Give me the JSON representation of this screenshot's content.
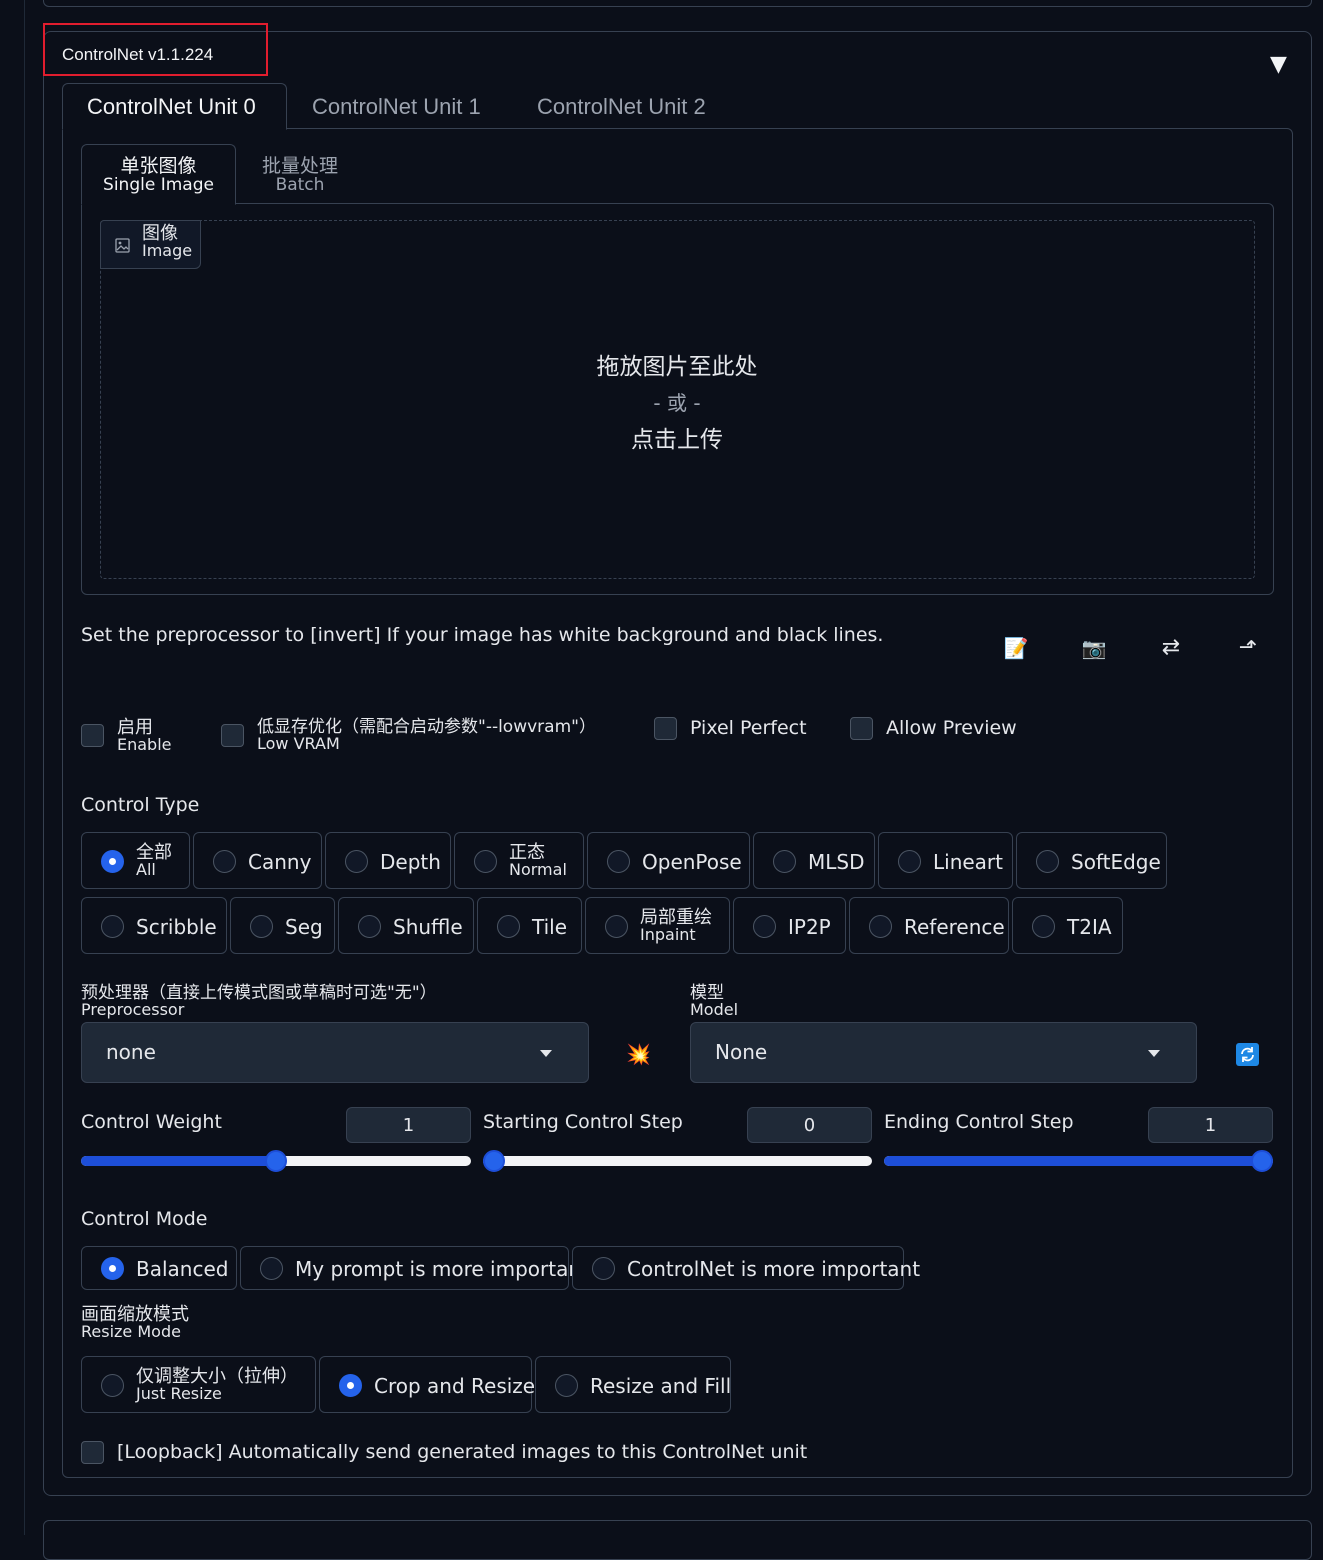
{
  "accordion": {
    "title": "ControlNet v1.1.224",
    "toggle_glyph": "▼"
  },
  "unit_tabs": [
    "ControlNet Unit 0",
    "ControlNet Unit 1",
    "ControlNet Unit 2"
  ],
  "input_tabs": {
    "single": {
      "cn": "单张图像",
      "en": "Single Image"
    },
    "batch": {
      "cn": "批量处理",
      "en": "Batch"
    }
  },
  "image_upload": {
    "label_cn": "图像",
    "label_en": "Image",
    "drop_text": "拖放图片至此处",
    "or_text": "- 或 -",
    "click_text": "点击上传"
  },
  "hint": "Set the preprocessor to [invert] If your image has white background and black lines.",
  "toolbar": {
    "edit": "📝",
    "camera": "📷",
    "swap": "⇄",
    "send": "⬏"
  },
  "options": {
    "enable": {
      "cn": "启用",
      "en": "Enable",
      "checked": false
    },
    "low_vram": {
      "cn": "低显存优化（需配合启动参数\"--lowvram\"）",
      "en": "Low VRAM",
      "checked": false
    },
    "pixel_perfect": {
      "label": "Pixel Perfect",
      "checked": false
    },
    "allow_preview": {
      "label": "Allow Preview",
      "checked": false
    }
  },
  "control_type": {
    "label": "Control Type",
    "selected": "all",
    "row1": [
      {
        "cn": "全部",
        "en": "All"
      },
      {
        "label": "Canny"
      },
      {
        "label": "Depth"
      },
      {
        "cn": "正态",
        "en": "Normal"
      },
      {
        "label": "OpenPose"
      },
      {
        "label": "MLSD"
      },
      {
        "label": "Lineart"
      },
      {
        "label": "SoftEdge"
      }
    ],
    "row2": [
      {
        "label": "Scribble"
      },
      {
        "label": "Seg"
      },
      {
        "label": "Shuffle"
      },
      {
        "label": "Tile"
      },
      {
        "cn": "局部重绘",
        "en": "Inpaint"
      },
      {
        "label": "IP2P"
      },
      {
        "label": "Reference"
      },
      {
        "label": "T2IA"
      }
    ]
  },
  "preprocessor": {
    "label_cn": "预处理器（直接上传模式图或草稿时可选\"无\"）",
    "label_en": "Preprocessor",
    "value": "none",
    "run_icon": "💥"
  },
  "model": {
    "label_cn": "模型",
    "label_en": "Model",
    "value": "None",
    "refresh_icon": "🔄"
  },
  "sliders": {
    "weight": {
      "label": "Control Weight",
      "value": "1",
      "fraction": 0.5
    },
    "start": {
      "label": "Starting Control Step",
      "value": "0",
      "fraction": 0.0
    },
    "end": {
      "label": "Ending Control Step",
      "value": "1",
      "fraction": 1.0
    }
  },
  "control_mode": {
    "label": "Control Mode",
    "options": [
      "Balanced",
      "My prompt is more important",
      "ControlNet is more important"
    ],
    "selected": "Balanced"
  },
  "resize_mode": {
    "label_cn": "画面缩放模式",
    "label_en": "Resize Mode",
    "just_resize": {
      "cn": "仅调整大小（拉伸）",
      "en": "Just Resize"
    },
    "crop_resize": "Crop and Resize",
    "resize_fill": "Resize and Fill",
    "selected": "Crop and Resize"
  },
  "loopback": {
    "label": "[Loopback] Automatically send generated images to this ControlNet unit",
    "checked": false
  }
}
